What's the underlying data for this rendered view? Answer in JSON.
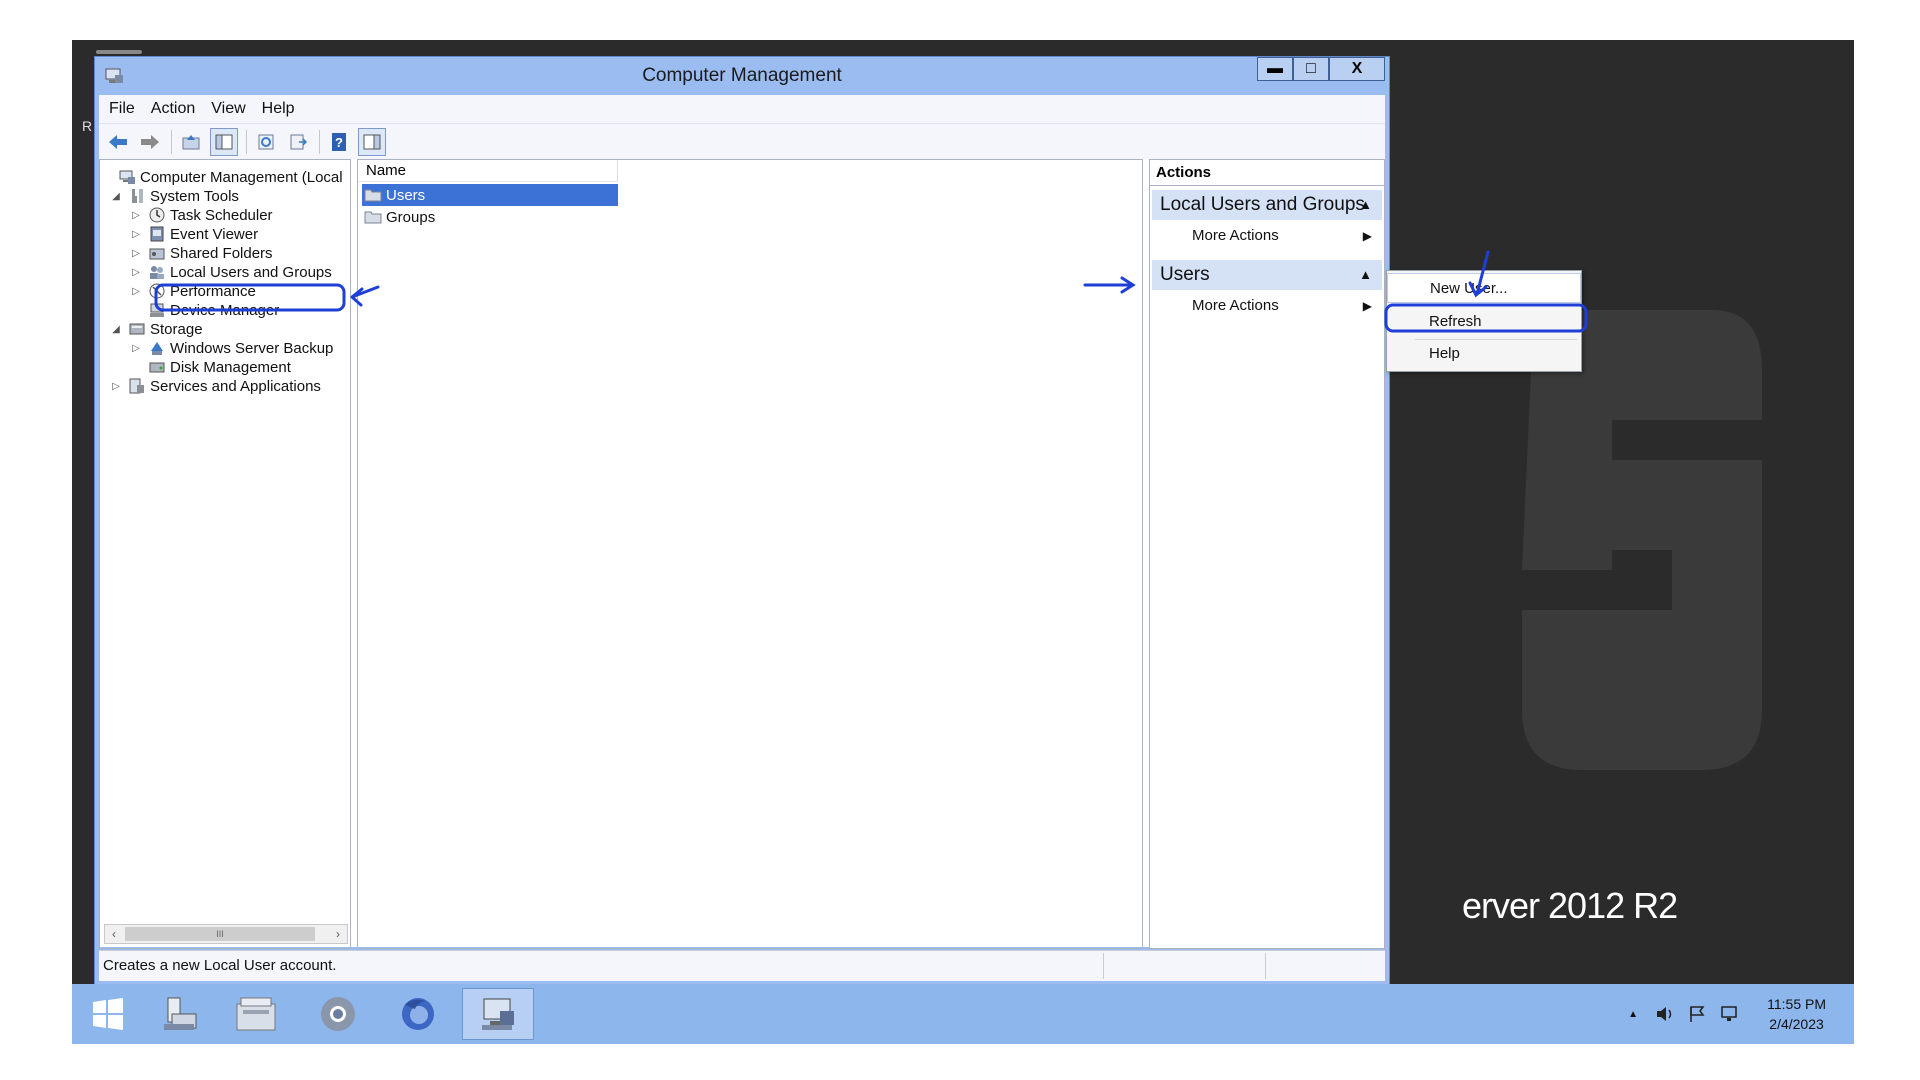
{
  "desktop": {
    "edge_letter": "R",
    "os_brand_text": "erver 2012 R2"
  },
  "window": {
    "title": "Computer Management",
    "minimize_glyph": "▬",
    "maximize_glyph": "□",
    "close_glyph": "X"
  },
  "menu": {
    "file": "File",
    "action": "Action",
    "view": "View",
    "help": "Help"
  },
  "tree": {
    "root": "Computer Management (Local",
    "system_tools": "System Tools",
    "task_scheduler": "Task Scheduler",
    "event_viewer": "Event Viewer",
    "shared_folders": "Shared Folders",
    "local_users_groups": "Local Users and Groups",
    "performance": "Performance",
    "device_manager": "Device Manager",
    "storage": "Storage",
    "windows_server_backup": "Windows Server Backup",
    "disk_management": "Disk Management",
    "services_apps": "Services and Applications",
    "scroll_thumb_glyph": "III"
  },
  "list": {
    "column_name": "Name",
    "items": [
      "Users",
      "Groups"
    ]
  },
  "actions": {
    "title": "Actions",
    "section1": "Local Users and Groups",
    "section1_more": "More Actions",
    "section2": "Users",
    "section2_more": "More Actions"
  },
  "context_menu": {
    "new_user": "New User...",
    "refresh": "Refresh",
    "help": "Help"
  },
  "status": {
    "text": "Creates a new Local User account."
  },
  "taskbar": {
    "time": "11:55 PM",
    "date": "2/4/2023",
    "tray_arrow": "▲"
  },
  "colors": {
    "window_frame": "#9bbcf0",
    "selection": "#3c72d6",
    "annotation": "#1e3fd6",
    "taskbar": "#8db6ec"
  }
}
